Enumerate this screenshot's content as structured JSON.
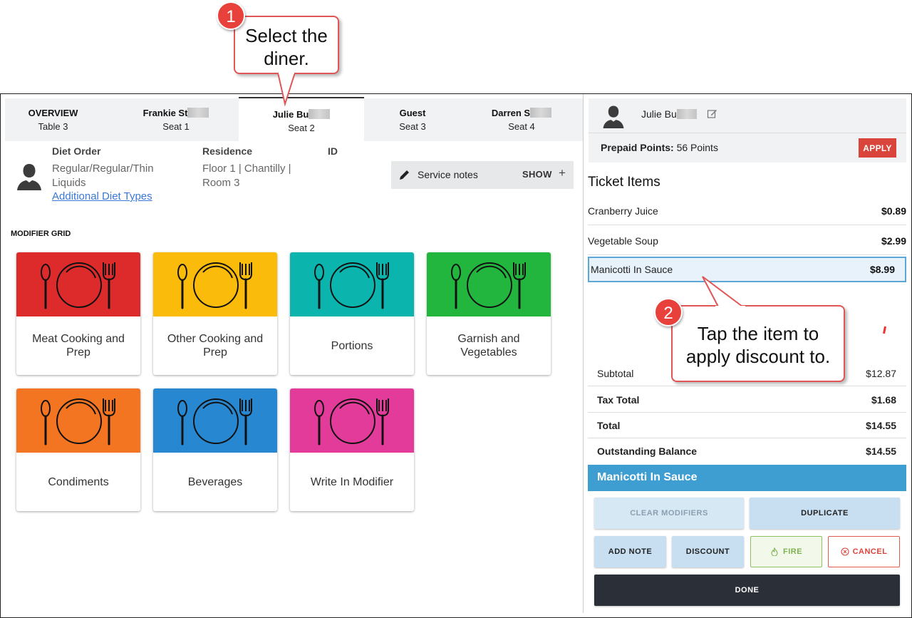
{
  "tabs": [
    {
      "title": "OVERVIEW",
      "sub": "Table 3"
    },
    {
      "title": "Frankie St",
      "sub": "Seat 1"
    },
    {
      "title": "Julie Bu",
      "sub": "Seat 2"
    },
    {
      "title": "Guest",
      "sub": "Seat 3"
    },
    {
      "title": "Darren S",
      "sub": "Seat 4"
    }
  ],
  "diner": {
    "diet_order_label": "Diet Order",
    "diet_order_line1": "Regular/Regular/Thin",
    "diet_order_line2": "Liquids",
    "additional_link": "Additional Diet Types",
    "residence_label": "Residence",
    "residence_line1": "Floor 1 | Chantilly |",
    "residence_line2": "Room 3",
    "id_label": "ID"
  },
  "service_notes": {
    "label": "Service notes",
    "toggle": "SHOW",
    "plus": "+"
  },
  "modifier_grid": {
    "title": "MODIFIER GRID",
    "items": [
      {
        "label": "Meat Cooking and Prep",
        "color": "#dd2a2a"
      },
      {
        "label": "Other Cooking and Prep",
        "color": "#fbbb0b"
      },
      {
        "label": "Portions",
        "color": "#0bb5ad"
      },
      {
        "label": "Garnish and Vegetables",
        "color": "#22b63e"
      },
      {
        "label": "Condiments",
        "color": "#f37421"
      },
      {
        "label": "Beverages",
        "color": "#2787d0"
      },
      {
        "label": "Write In Modifier",
        "color": "#e23b9a"
      }
    ]
  },
  "right_panel": {
    "diner_name": "Julie Bu",
    "prepaid_label": "Prepaid Points:",
    "prepaid_value": "56 Points",
    "apply": "APPLY",
    "ticket_title": "Ticket Items",
    "items": [
      {
        "name": "Cranberry Juice",
        "price": "$0.89"
      },
      {
        "name": "Vegetable Soup",
        "price": "$2.99"
      },
      {
        "name": "Manicotti In Sauce",
        "price": "$8.99"
      }
    ],
    "subtotal_label": "Subtotal",
    "subtotal": "$12.87",
    "tax_label": "Tax Total",
    "tax": "$1.68",
    "total_label": "Total",
    "total": "$14.55",
    "balance_label": "Outstanding Balance",
    "balance": "$14.55",
    "selected_item": "Manicotti In Sauce",
    "buttons": {
      "clear": "CLEAR MODIFIERS",
      "duplicate": "DUPLICATE",
      "add_note": "ADD NOTE",
      "discount": "DISCOUNT",
      "fire": "FIRE",
      "cancel": "CANCEL",
      "done": "DONE"
    }
  },
  "callouts": [
    {
      "number": "1",
      "line1": "Select the",
      "line2": "diner."
    },
    {
      "number": "2",
      "line1": "Tap the item to",
      "line2": "apply discount to."
    }
  ]
}
